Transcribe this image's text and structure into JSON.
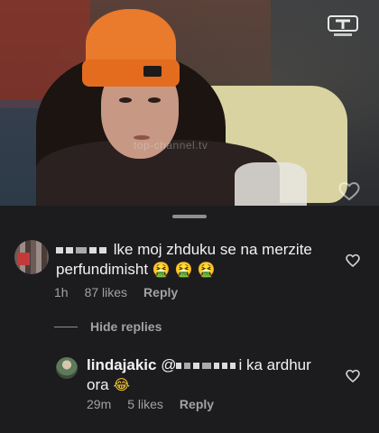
{
  "video": {
    "watermark": "top-channel.tv",
    "channel_logo_icon": "channel-logo-icon",
    "like_icon": "heart-outline-icon"
  },
  "comments": [
    {
      "username_redacted": true,
      "text": "lke moj zhduku se na merzite perfundimisht",
      "emoji": "🤮 🤮 🤮",
      "time": "1h",
      "likes": "87 likes",
      "reply_label": "Reply"
    }
  ],
  "hide_replies_label": "Hide replies",
  "replies": [
    {
      "username": "lindajakic",
      "text_prefix": "@",
      "text_suffix": "i ka ardhur",
      "text_line2": "ora",
      "emoji": "😂",
      "time": "29m",
      "likes": "5 likes",
      "reply_label": "Reply"
    }
  ],
  "colors": {
    "sheet_bg": "#1c1c1e",
    "text_primary": "#f2f2f2",
    "text_secondary": "#a1a1a6",
    "beanie_orange": "#ea7a2c"
  }
}
